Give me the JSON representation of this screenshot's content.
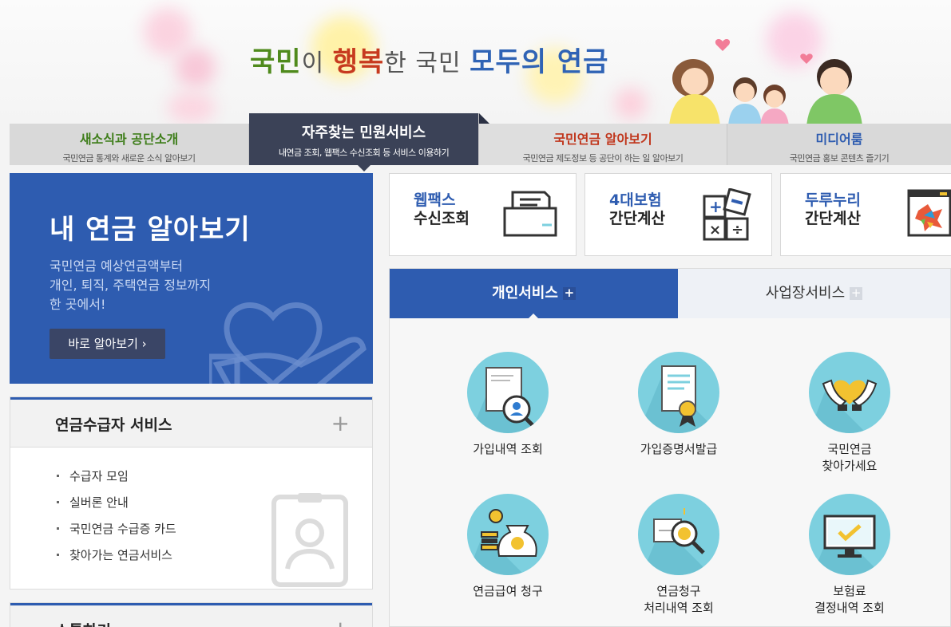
{
  "banner": {
    "slogan_1": "국민",
    "slogan_2": "이 ",
    "slogan_3": "행복",
    "slogan_4": "한 국민 ",
    "slogan_5": "모두의 연금"
  },
  "nav": {
    "tabs": [
      {
        "title": "새소식과 공단소개",
        "desc": "국민연금 통계와 새로운 소식 알아보기",
        "color": "#3f7e1b"
      },
      {
        "title": "자주찾는 민원서비스",
        "desc": "내연금 조회, 웹팩스 수신조회 등 서비스 이용하기",
        "color": "#ffffff"
      },
      {
        "title": "국민연금 알아보기",
        "desc": "국민연금 제도정보 등 공단이 하는 일 알아보기",
        "color": "#c0361c"
      },
      {
        "title": "미디어룸",
        "desc": "국민연금 홍보 콘텐츠 즐기기",
        "color": "#2e5cb0"
      }
    ]
  },
  "promo": {
    "title": "내 연금 알아보기",
    "desc": "국민연금 예상연금액부터\n개인, 퇴직, 주택연금 정보까지\n한 곳에서!",
    "button": "바로 알아보기 ›"
  },
  "pensioner": {
    "title": "연금수급자 서비스",
    "plus": "+",
    "items": [
      "수급자 모임",
      "실버론 안내",
      "국민연금 수급증 카드",
      "찾아가는 연금서비스"
    ]
  },
  "communication": {
    "title": "소통하기",
    "plus": "+"
  },
  "quick": [
    {
      "line1": "웹팩스",
      "line2": "수신조회",
      "icon": "fax-icon"
    },
    {
      "line1": "4대보험",
      "line2": "간단계산",
      "icon": "calculator-icon"
    },
    {
      "line1": "두루누리",
      "line2": "간단계산",
      "icon": "durunuri-icon"
    }
  ],
  "service_tabs": {
    "personal": "개인서비스",
    "business": "사업장서비스",
    "plus": "+"
  },
  "services": [
    {
      "label": "가입내역 조회",
      "icon": "document-search-icon"
    },
    {
      "label": "가입증명서발급",
      "icon": "certificate-icon"
    },
    {
      "label": "국민연금\n찾아가세요",
      "icon": "heart-hands-icon"
    },
    {
      "label": "연금급여 청구",
      "icon": "money-bag-icon"
    },
    {
      "label": "연금청구\n처리내역 조회",
      "icon": "claim-search-icon"
    },
    {
      "label": "보험료\n결정내역 조회",
      "icon": "monitor-check-icon"
    }
  ],
  "colors": {
    "brand_blue": "#2e5cb0",
    "nav_active": "#3b4257",
    "icon_circle": "#7dd0df"
  }
}
